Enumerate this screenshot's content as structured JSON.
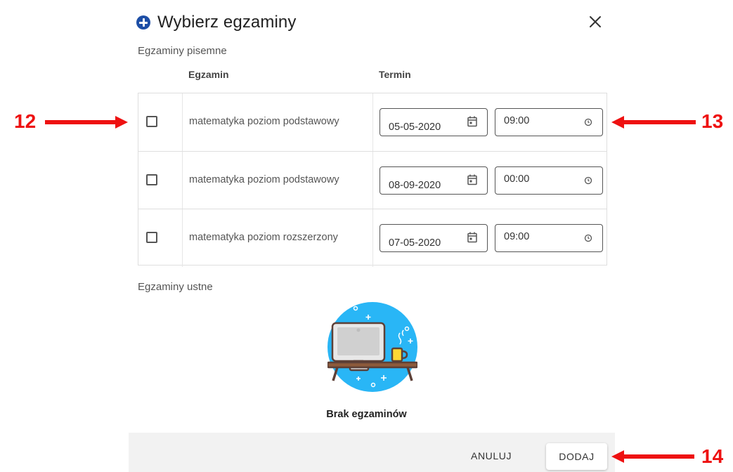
{
  "dialog": {
    "title": "Wybierz egzaminy",
    "accent_color": "#1d4ea6"
  },
  "written": {
    "section_label": "Egzaminy pisemne",
    "col_exam": "Egzamin",
    "col_term": "Termin",
    "rows": [
      {
        "checked": false,
        "exam": "matematyka poziom podstawowy",
        "date": "05-05-2020",
        "time": "09:00"
      },
      {
        "checked": false,
        "exam": "matematyka poziom podstawowy",
        "date": "08-09-2020",
        "time": "00:00"
      },
      {
        "checked": false,
        "exam": "matematyka poziom rozszerzony",
        "date": "07-05-2020",
        "time": "09:00"
      }
    ]
  },
  "oral": {
    "section_label": "Egzaminy ustne",
    "empty_text": "Brak egzaminów"
  },
  "footer": {
    "cancel_label": "ANULUJ",
    "add_label": "DODAJ"
  },
  "annotations": {
    "left_number": "12",
    "right_number": "13",
    "footer_number": "14",
    "arrow_color": "#ee1111"
  },
  "icons": [
    "add-circle-icon",
    "close-icon",
    "calendar-icon",
    "clock-icon"
  ]
}
